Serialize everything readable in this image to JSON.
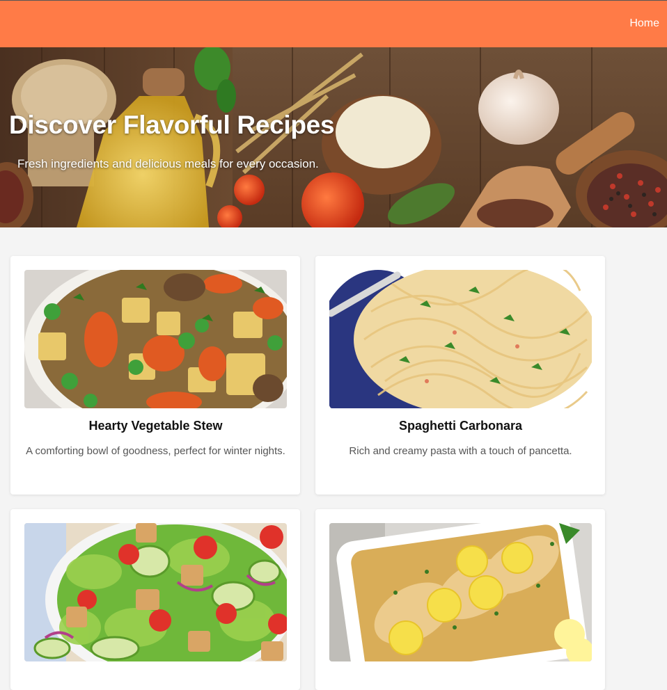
{
  "nav": {
    "home_label": "Home"
  },
  "hero": {
    "title": "Discover Flavorful Recipes",
    "subtitle": "Fresh ingredients and delicious meals for every occasion."
  },
  "recipes": [
    {
      "title": "Hearty Vegetable Stew",
      "description": "A comforting bowl of goodness, perfect for winter nights."
    },
    {
      "title": "Spaghetti Carbonara",
      "description": "Rich and creamy pasta with a touch of pancetta."
    },
    {
      "title": "",
      "description": ""
    },
    {
      "title": "",
      "description": ""
    }
  ],
  "colors": {
    "nav_background": "#ff7b47",
    "page_background": "#f4f4f4",
    "card_background": "#ffffff"
  }
}
